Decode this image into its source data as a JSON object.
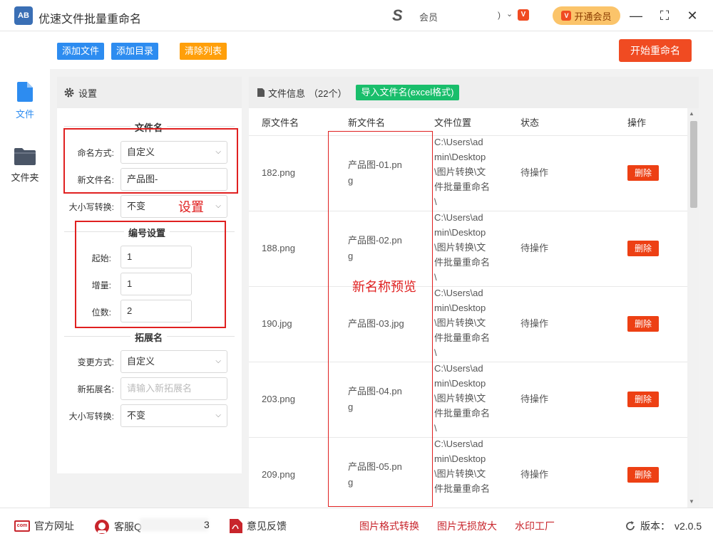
{
  "app": {
    "logo": "AB",
    "title": "优速文件批量重命名",
    "user_logo": "S",
    "user_name": "会员",
    "user_fragment": ")",
    "vip_small": "V",
    "vip_button": "开通会员",
    "vip_mark": "V"
  },
  "window": {
    "minimize": "—",
    "maximize": "⛶",
    "close": "✕"
  },
  "nav": {
    "files_label": "文件",
    "folder_label": "文件夹"
  },
  "toolbar": {
    "add_file": "添加文件",
    "add_dir": "添加目录",
    "clear_list": "清除列表",
    "start": "开始重命名"
  },
  "settings": {
    "header": "设置",
    "filename_section": "文件名",
    "naming_mode_label": "命名方式:",
    "naming_mode_value": "自定义",
    "new_name_label": "新文件名:",
    "new_name_value": "产品图-",
    "case_label": "大小写转换:",
    "case_value": "不变",
    "numbering_section": "编号设置",
    "start_label": "起始:",
    "start_value": "1",
    "increment_label": "增量:",
    "increment_value": "1",
    "digits_label": "位数:",
    "digits_value": "2",
    "ext_section": "拓展名",
    "ext_mode_label": "变更方式:",
    "ext_mode_value": "自定义",
    "new_ext_label": "新拓展名:",
    "new_ext_placeholder": "请输入新拓展名",
    "ext_case_label": "大小写转换:",
    "ext_case_value": "不变"
  },
  "files": {
    "header": "文件信息",
    "count": "（22个）",
    "import_btn": "导入文件名(excel格式)",
    "columns": [
      "原文件名",
      "新文件名",
      "文件位置",
      "状态",
      "操作"
    ],
    "rows": [
      {
        "original": "182.png",
        "new_l1": "产品图-01.pn",
        "new_l2": "g",
        "path": [
          "C:\\Users\\ad",
          "min\\Desktop",
          "\\图片转换\\文",
          "件批量重命名",
          "\\"
        ],
        "status": "待操作",
        "action": "删除"
      },
      {
        "original": "188.png",
        "new_l1": "产品图-02.pn",
        "new_l2": "g",
        "path": [
          "C:\\Users\\ad",
          "min\\Desktop",
          "\\图片转换\\文",
          "件批量重命名",
          "\\"
        ],
        "status": "待操作",
        "action": "删除"
      },
      {
        "original": "190.jpg",
        "new_l1": "产品图-03.jpg",
        "new_l2": "",
        "path": [
          "C:\\Users\\ad",
          "min\\Desktop",
          "\\图片转换\\文",
          "件批量重命名",
          "\\"
        ],
        "status": "待操作",
        "action": "删除"
      },
      {
        "original": "203.png",
        "new_l1": "产品图-04.pn",
        "new_l2": "g",
        "path": [
          "C:\\Users\\ad",
          "min\\Desktop",
          "\\图片转换\\文",
          "件批量重命名",
          "\\"
        ],
        "status": "待操作",
        "action": "删除"
      },
      {
        "original": "209.png",
        "new_l1": "产品图-05.pn",
        "new_l2": "g",
        "path": [
          "C:\\Users\\ad",
          "min\\Desktop",
          "\\图片转换\\文",
          "件批量重命名",
          "\\"
        ],
        "status": "待操作",
        "action": "删除"
      }
    ]
  },
  "annotations": {
    "settings": "设置",
    "preview": "新名称预览"
  },
  "footer": {
    "website_icon": "com",
    "website": "官方网址",
    "service": "客服Q",
    "service_number": "3",
    "feedback": "意见反馈",
    "link1": "图片格式转换",
    "link2": "图片无损放大",
    "link3": "水印工厂",
    "version_label": "版本：",
    "version": "v2.0.5"
  },
  "colors": {
    "accent": "#2d8cf0",
    "danger": "#f04b22",
    "success": "#19be6b",
    "warning": "#ff9f0a"
  }
}
